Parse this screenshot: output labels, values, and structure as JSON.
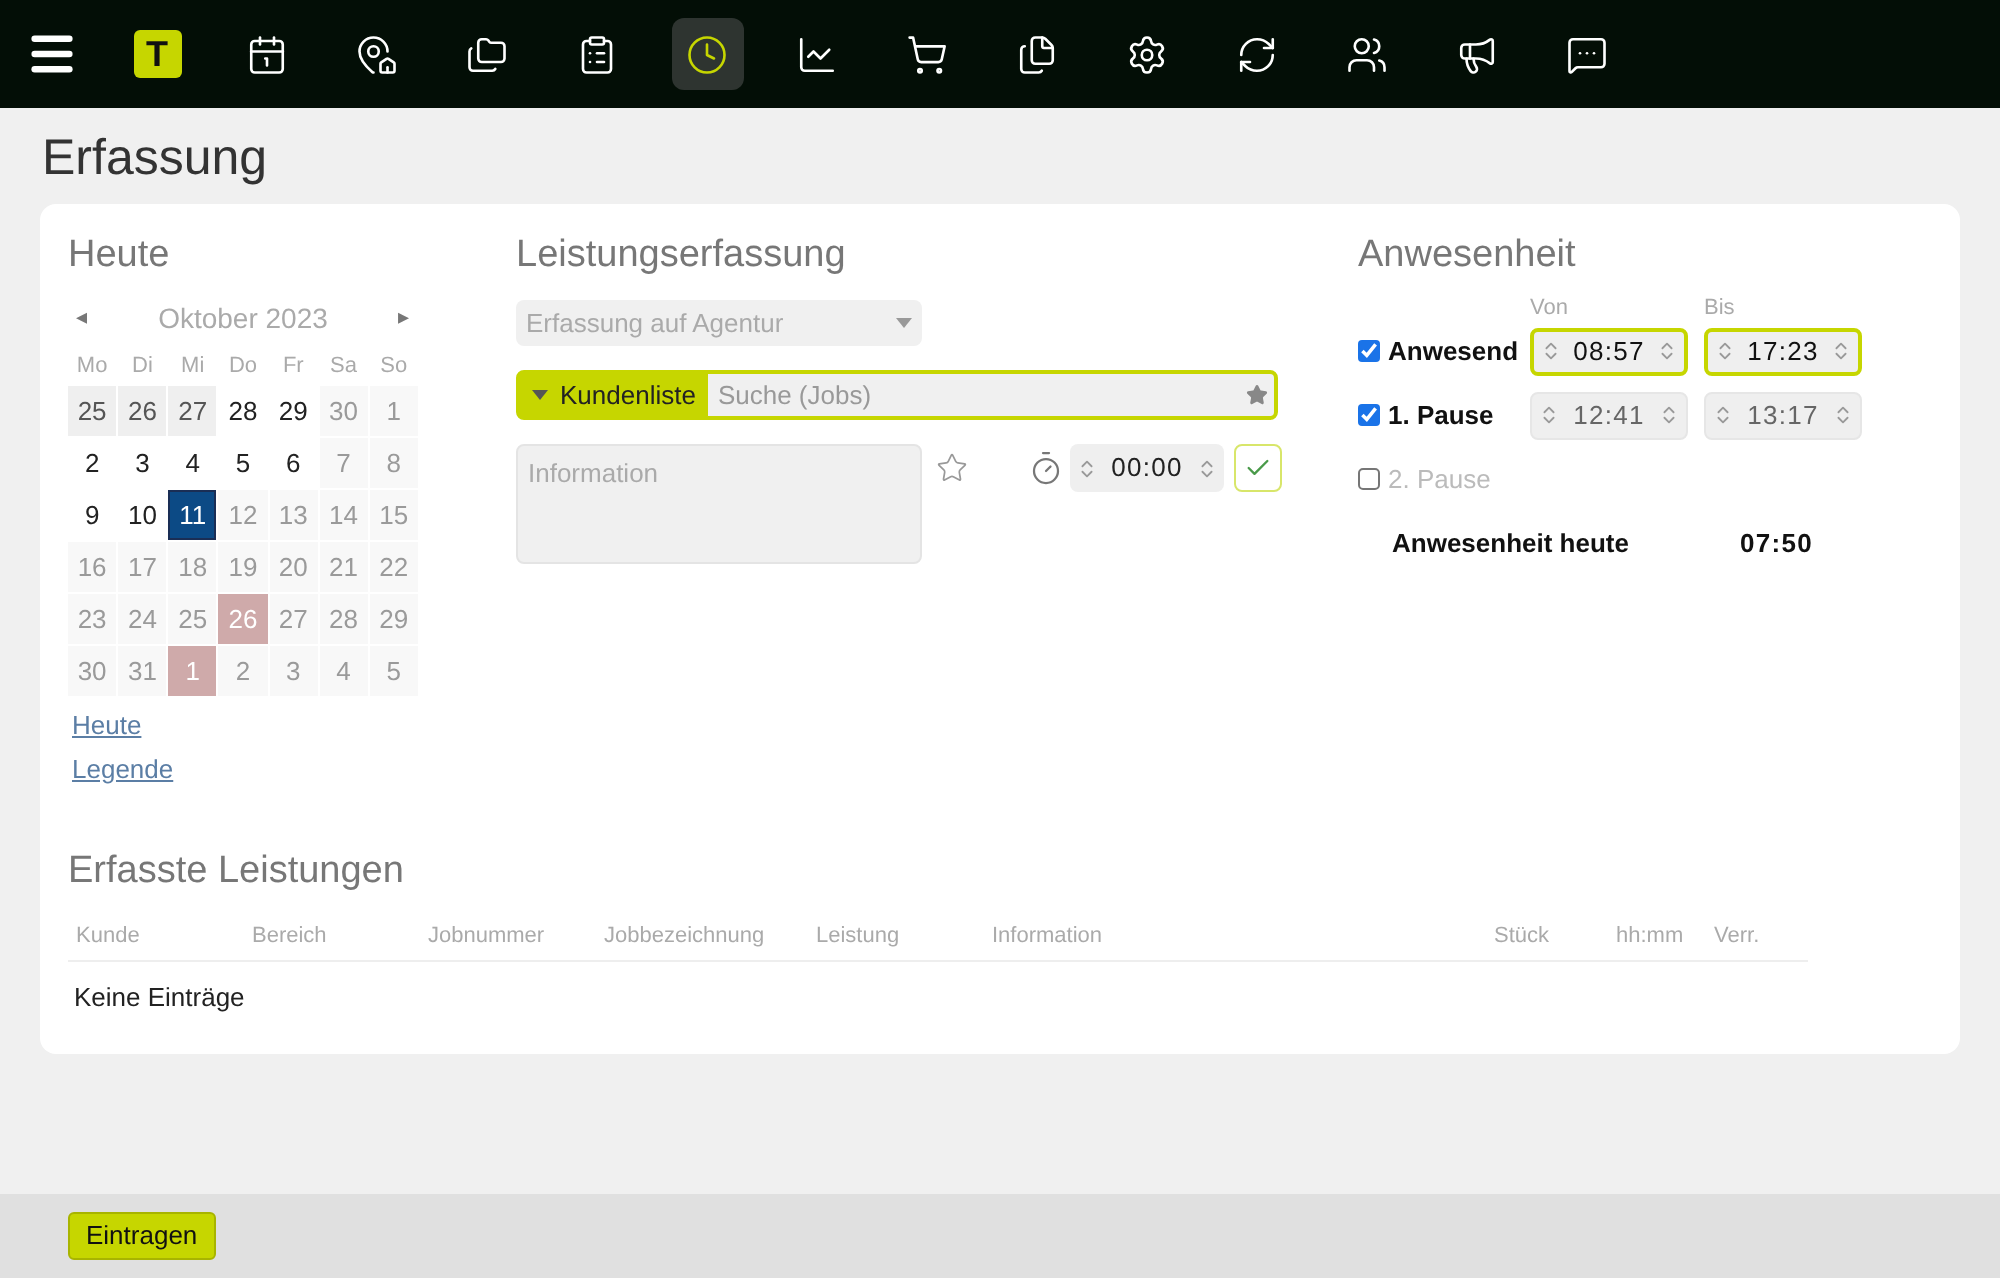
{
  "nav": [
    {
      "kind": "menu",
      "selected": false
    },
    {
      "kind": "logo",
      "label": "T",
      "selected": false
    },
    {
      "kind": "calendar",
      "selected": false
    },
    {
      "kind": "house-pin",
      "selected": false
    },
    {
      "kind": "folders",
      "selected": false
    },
    {
      "kind": "checklist",
      "selected": false
    },
    {
      "kind": "clock",
      "selected": true
    },
    {
      "kind": "chart",
      "selected": false
    },
    {
      "kind": "cart",
      "selected": false
    },
    {
      "kind": "files",
      "selected": false
    },
    {
      "kind": "settings",
      "selected": false
    },
    {
      "kind": "refresh",
      "selected": false
    },
    {
      "kind": "users",
      "selected": false
    },
    {
      "kind": "megaphone",
      "selected": false
    },
    {
      "kind": "chat",
      "selected": false
    }
  ],
  "page_title": "Erfassung",
  "today": {
    "title": "Heute",
    "month": "Oktober 2023",
    "prev": "◂",
    "next": "▸",
    "weekdays": [
      "Mo",
      "Di",
      "Mi",
      "Do",
      "Fr",
      "Sa",
      "So"
    ],
    "days": [
      {
        "label": "25",
        "kind": "outside",
        "selected": false
      },
      {
        "label": "26",
        "kind": "outside",
        "selected": false
      },
      {
        "label": "27",
        "kind": "outside",
        "selected": false
      },
      {
        "label": "28",
        "kind": "day",
        "selected": false
      },
      {
        "label": "29",
        "kind": "day",
        "selected": false
      },
      {
        "label": "30",
        "kind": "inactive",
        "selected": false
      },
      {
        "label": "1",
        "kind": "inactive",
        "selected": false
      },
      {
        "label": "2",
        "kind": "day",
        "selected": false
      },
      {
        "label": "3",
        "kind": "day",
        "selected": false
      },
      {
        "label": "4",
        "kind": "day",
        "selected": false
      },
      {
        "label": "5",
        "kind": "day",
        "selected": false
      },
      {
        "label": "6",
        "kind": "day",
        "selected": false
      },
      {
        "label": "7",
        "kind": "inactive",
        "selected": false
      },
      {
        "label": "8",
        "kind": "inactive",
        "selected": false
      },
      {
        "label": "9",
        "kind": "day",
        "selected": false
      },
      {
        "label": "10",
        "kind": "day",
        "selected": false
      },
      {
        "label": "11",
        "kind": "day",
        "selected": true
      },
      {
        "label": "12",
        "kind": "inactive",
        "selected": false
      },
      {
        "label": "13",
        "kind": "inactive",
        "selected": false
      },
      {
        "label": "14",
        "kind": "inactive",
        "selected": false
      },
      {
        "label": "15",
        "kind": "inactive",
        "selected": false
      },
      {
        "label": "16",
        "kind": "inactive",
        "selected": false
      },
      {
        "label": "17",
        "kind": "inactive",
        "selected": false
      },
      {
        "label": "18",
        "kind": "inactive",
        "selected": false
      },
      {
        "label": "19",
        "kind": "inactive",
        "selected": false
      },
      {
        "label": "20",
        "kind": "inactive",
        "selected": false
      },
      {
        "label": "21",
        "kind": "inactive",
        "selected": false
      },
      {
        "label": "22",
        "kind": "inactive",
        "selected": false
      },
      {
        "label": "23",
        "kind": "inactive",
        "selected": false
      },
      {
        "label": "24",
        "kind": "inactive",
        "selected": false
      },
      {
        "label": "25",
        "kind": "inactive",
        "selected": false
      },
      {
        "label": "26",
        "kind": "marked",
        "selected": false
      },
      {
        "label": "27",
        "kind": "inactive",
        "selected": false
      },
      {
        "label": "28",
        "kind": "inactive",
        "selected": false
      },
      {
        "label": "29",
        "kind": "inactive",
        "selected": false
      },
      {
        "label": "30",
        "kind": "inactive",
        "selected": false
      },
      {
        "label": "31",
        "kind": "inactive",
        "selected": false
      },
      {
        "label": "1",
        "kind": "marked",
        "selected": false
      },
      {
        "label": "2",
        "kind": "inactive",
        "selected": false
      },
      {
        "label": "3",
        "kind": "inactive",
        "selected": false
      },
      {
        "label": "4",
        "kind": "inactive",
        "selected": false
      },
      {
        "label": "5",
        "kind": "inactive",
        "selected": false
      }
    ],
    "links": [
      "Heute",
      "Legende"
    ]
  },
  "entry": {
    "title": "Leistungserfassung",
    "mode_select": "Erfassung auf Agentur",
    "list_button": "Kundenliste",
    "search": {
      "placeholder": "Suche (Jobs)"
    },
    "info": {
      "placeholder": "Information"
    },
    "duration": "00:00"
  },
  "attendance": {
    "title": "Anwesenheit",
    "from_label": "Von",
    "to_label": "Bis",
    "rows": [
      {
        "label": "Anwesend",
        "checked": true,
        "from": "08:57",
        "to": "17:23",
        "highlighted": true
      },
      {
        "label": "1. Pause",
        "checked": true,
        "from": "12:41",
        "to": "13:17",
        "highlighted": false
      },
      {
        "label": "2. Pause",
        "checked": false
      }
    ],
    "total_label": "Anwesenheit heute",
    "total": "07:50"
  },
  "entries": {
    "title": "Erfasste Leistungen",
    "columns": [
      "Kunde",
      "Bereich",
      "Jobnummer",
      "Jobbezeichnung",
      "Leistung",
      "Information",
      "Stück",
      "hh:mm",
      "Verr."
    ],
    "empty": "Keine Einträge"
  },
  "submit": "Eintragen"
}
